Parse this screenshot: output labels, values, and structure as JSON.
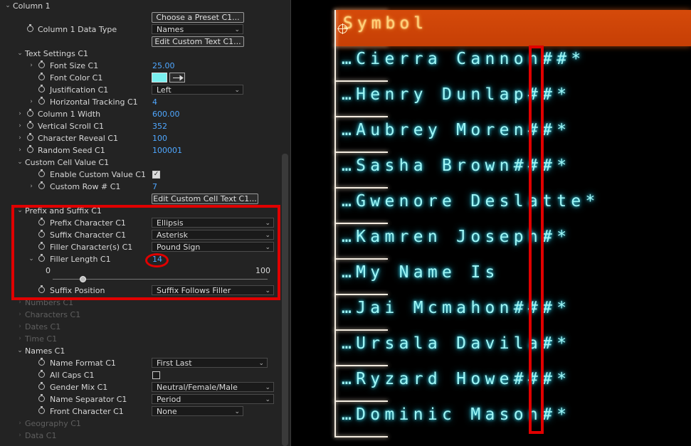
{
  "panel": {
    "section_title": "Column 1",
    "choose_preset_button": "Choose a Preset C1...",
    "data_type": {
      "label": "Column 1 Data Type",
      "value": "Names"
    },
    "edit_custom_text_button": "Edit Custom Text C1...",
    "text_settings": {
      "label": "Text Settings C1",
      "font_size": {
        "label": "Font Size C1",
        "value": "25.00"
      },
      "font_color": {
        "label": "Font Color C1",
        "color": "#79f0f0"
      },
      "justification": {
        "label": "Justification C1",
        "value": "Left"
      },
      "horizontal_tracking": {
        "label": "Horizontal Tracking C1",
        "value": "4"
      }
    },
    "column_width": {
      "label": "Column 1 Width",
      "value": "600.00"
    },
    "vertical_scroll": {
      "label": "Vertical Scroll C1",
      "value": "352"
    },
    "character_reveal": {
      "label": "Character Reveal C1",
      "value": "100"
    },
    "random_seed": {
      "label": "Random Seed C1",
      "value": "100001"
    },
    "custom_cell_value": {
      "label": "Custom Cell Value C1",
      "enable": {
        "label": "Enable Custom Value C1",
        "checked": true
      },
      "custom_row": {
        "label": "Custom Row # C1",
        "value": "7"
      },
      "edit_button": "Edit Custom Cell Text C1..."
    },
    "prefix_suffix": {
      "label": "Prefix and Suffix C1",
      "prefix": {
        "label": "Prefix Character C1",
        "value": "Ellipsis"
      },
      "suffix": {
        "label": "Suffix Character C1",
        "value": "Asterisk"
      },
      "filler": {
        "label": "Filler Character(s) C1",
        "value": "Pound Sign"
      },
      "filler_length": {
        "label": "Filler Length C1",
        "value": "14",
        "min": "0",
        "max": "100",
        "level": 14
      },
      "suffix_position": {
        "label": "Suffix Position",
        "value": "Suffix Follows Filler"
      }
    },
    "collapsed_groups": [
      "Numbers C1",
      "Characters C1",
      "Dates C1",
      "Time C1"
    ],
    "names": {
      "label": "Names C1",
      "name_format": {
        "label": "Name Format C1",
        "value": "First Last"
      },
      "all_caps": {
        "label": "All Caps C1",
        "checked": false
      },
      "gender_mix": {
        "label": "Gender Mix C1",
        "value": "Neutral/Female/Male"
      },
      "name_separator": {
        "label": "Name Separator C1",
        "value": "Period"
      },
      "front_character": {
        "label": "Front Character C1",
        "value": "None"
      }
    },
    "collapsed_groups_after": [
      "Geography C1",
      "Data C1"
    ]
  },
  "preview": {
    "header": "Symbol",
    "rows": [
      "…Cierra Cannon##*",
      "…Henry Dunlap##*",
      "…Aubrey Moren##*",
      "…Sasha Brown###*",
      "…Gwenore Deslatte*",
      "…Kamren Joseph#*",
      "…My Name Is",
      "…Jai Mcmahon###*",
      "…Ursala Davila#*",
      "…Ryzard Howe###*",
      "…Dominic Mason#*"
    ]
  },
  "colors": {
    "accent_orange": "#d54a0a",
    "glow_cyan": "#9ff6f6",
    "highlight_red": "#e00000",
    "value_blue": "#4fa7ff"
  }
}
